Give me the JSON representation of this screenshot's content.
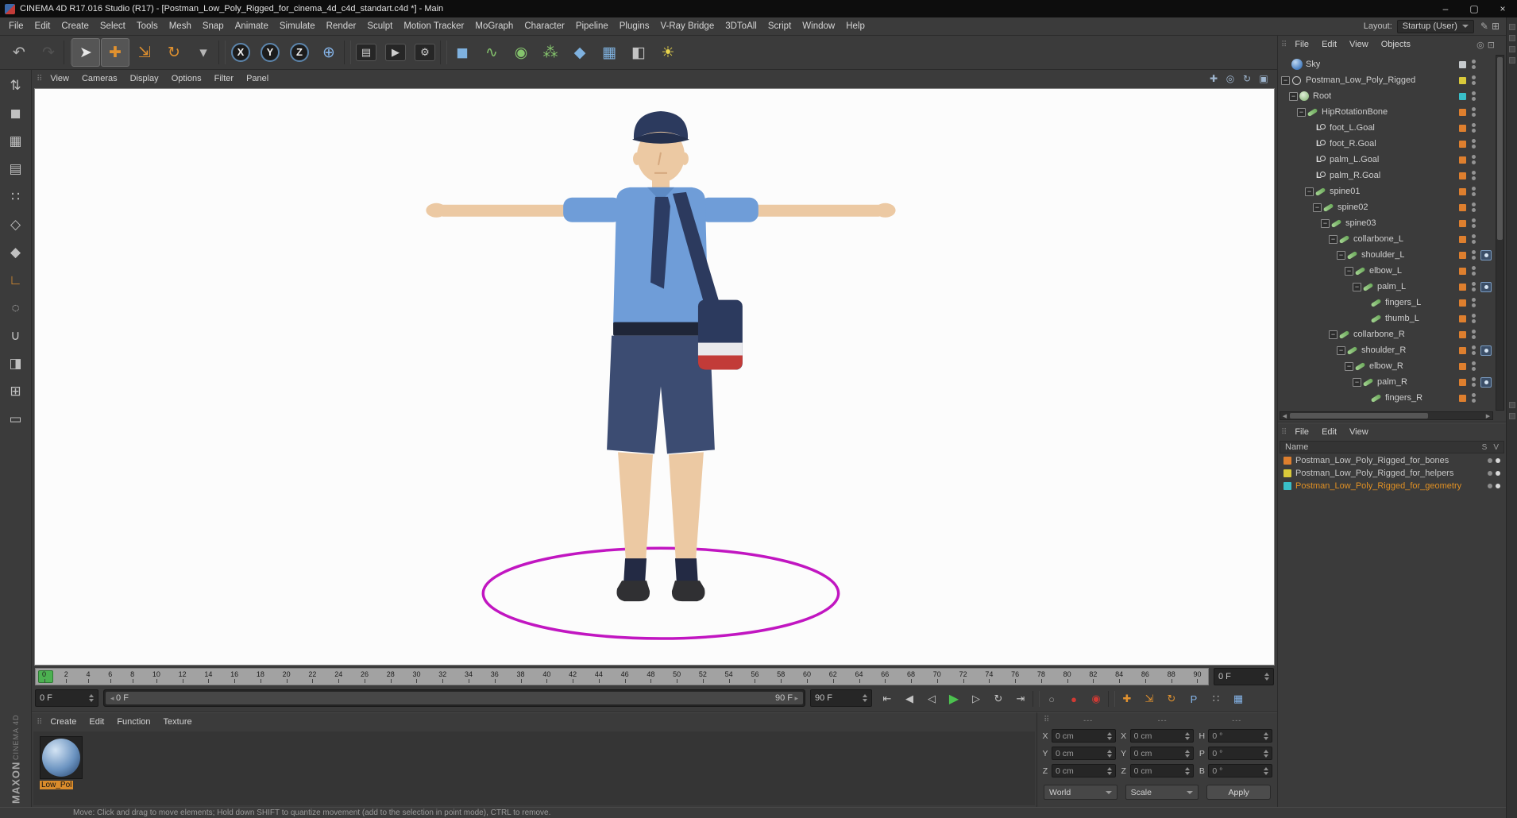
{
  "window": {
    "title": "CINEMA 4D R17.016 Studio (R17) - [Postman_Low_Poly_Rigged_for_cinema_4d_c4d_standart.c4d *] - Main",
    "controls": [
      {
        "name": "minimize-button",
        "glyph": "–"
      },
      {
        "name": "maximize-button",
        "glyph": "▢"
      },
      {
        "name": "close-button",
        "glyph": "×"
      }
    ]
  },
  "menubar": {
    "items": [
      "File",
      "Edit",
      "Create",
      "Select",
      "Tools",
      "Mesh",
      "Snap",
      "Animate",
      "Simulate",
      "Render",
      "Sculpt",
      "Motion Tracker",
      "MoGraph",
      "Character",
      "Pipeline",
      "Plugins",
      "V-Ray Bridge",
      "3DToAll",
      "Script",
      "Window",
      "Help"
    ],
    "layout_label": "Layout:",
    "layout_value": "Startup (User)",
    "right_icons": [
      {
        "name": "interface-edit-icon",
        "glyph": "✎"
      },
      {
        "name": "layout-grid-icon",
        "glyph": "⊞"
      }
    ]
  },
  "toolbar": {
    "icons": [
      {
        "name": "undo-icon",
        "glyph": "↶",
        "color": "#b5b5b5"
      },
      {
        "name": "redo-icon",
        "glyph": "↷",
        "color": "#666666",
        "disabled": true
      },
      {
        "sep": true
      },
      {
        "name": "live-selection-icon",
        "glyph": "➤",
        "color": "#e8e8e8",
        "active": true
      },
      {
        "name": "move-tool-icon",
        "glyph": "✚",
        "color": "#e0912f",
        "active": true
      },
      {
        "name": "scale-tool-icon",
        "glyph": "⇲",
        "color": "#e0912f"
      },
      {
        "name": "rotate-tool-icon",
        "glyph": "↻",
        "color": "#e0912f"
      },
      {
        "name": "last-tool-icon",
        "glyph": "▾",
        "color": "#b5b5b5"
      },
      {
        "sep": true
      },
      {
        "name": "x-axis-lock-icon",
        "glyph": "X",
        "color": "#f0f0f0",
        "chip": "circle"
      },
      {
        "name": "y-axis-lock-icon",
        "glyph": "Y",
        "color": "#f0f0f0",
        "chip": "circle"
      },
      {
        "name": "z-axis-lock-icon",
        "glyph": "Z",
        "color": "#f0f0f0",
        "chip": "circle"
      },
      {
        "name": "coordinate-system-icon",
        "glyph": "⊕",
        "color": "#85b4e8"
      },
      {
        "sep": true
      },
      {
        "name": "render-view-icon",
        "glyph": "▤",
        "color": "#cfcfcf",
        "chip": "dark"
      },
      {
        "name": "render-picture-viewer-icon",
        "glyph": "▶",
        "color": "#cfcfcf",
        "chip": "dark"
      },
      {
        "name": "render-settings-icon",
        "glyph": "⚙",
        "color": "#cfcfcf",
        "chip": "dark"
      },
      {
        "sep": true
      },
      {
        "name": "primitive-cube-icon",
        "glyph": "◼",
        "color": "#7fb2e0"
      },
      {
        "name": "spline-pen-icon",
        "glyph": "∿",
        "color": "#85c46d"
      },
      {
        "name": "subdivision-surface-icon",
        "glyph": "◉",
        "color": "#85c46d"
      },
      {
        "name": "cloner-icon",
        "glyph": "⁂",
        "color": "#85c46d"
      },
      {
        "name": "deformer-icon",
        "glyph": "◆",
        "color": "#7fb2e0"
      },
      {
        "name": "environment-icon",
        "glyph": "▦",
        "color": "#7fb2e0"
      },
      {
        "name": "camera-icon",
        "glyph": "◧",
        "color": "#c4c4c4"
      },
      {
        "name": "light-icon",
        "glyph": "☀",
        "color": "#e8d44c"
      }
    ]
  },
  "left_palette": {
    "icons": [
      {
        "name": "make-editable-icon",
        "glyph": "⇅",
        "color": "#c0c0c0"
      },
      {
        "name": "model-mode-icon",
        "glyph": "◼",
        "color": "#c0c0c0"
      },
      {
        "name": "texture-mode-icon",
        "glyph": "▦",
        "color": "#c0c0c0"
      },
      {
        "name": "workplane-mode-icon",
        "glyph": "▤",
        "color": "#c0c0c0"
      },
      {
        "name": "point-mode-icon",
        "glyph": "∷",
        "color": "#c0c0c0"
      },
      {
        "name": "edge-mode-icon",
        "glyph": "◇",
        "color": "#c0c0c0"
      },
      {
        "name": "polygon-mode-icon",
        "glyph": "◆",
        "color": "#c0c0c0"
      },
      {
        "name": "axis-mode-icon",
        "glyph": "∟",
        "color": "#e0912f"
      },
      {
        "name": "object-mode-icon",
        "glyph": "◌",
        "color": "#c0c0c0"
      },
      {
        "name": "snap-icon",
        "glyph": "∪",
        "color": "#c0c0c0"
      },
      {
        "name": "paint-tool-icon",
        "glyph": "◨",
        "color": "#c0c0c0"
      },
      {
        "name": "texture-axis-icon",
        "glyph": "⊞",
        "color": "#c0c0c0"
      },
      {
        "name": "viewport-solo-icon",
        "glyph": "▭",
        "color": "#c0c0c0"
      }
    ]
  },
  "viewport": {
    "menu": [
      "View",
      "Cameras",
      "Display",
      "Options",
      "Filter",
      "Panel"
    ],
    "view_icons": [
      {
        "name": "pan-view-icon",
        "glyph": "✚"
      },
      {
        "name": "zoom-view-icon",
        "glyph": "◎"
      },
      {
        "name": " rotate-view-icon",
        "glyph": "↻"
      },
      {
        "name": "toggle-view-icon",
        "glyph": "▣"
      }
    ]
  },
  "scene": {
    "description": "Low-poly postman character in T-pose over magenta ground ring",
    "colors": {
      "ring": "#c116c1",
      "skin": "#ecc9a3",
      "skin_line": "#d5a87e",
      "shirt": "#6f9dd8",
      "collar": "#5d8ac4",
      "tie": "#2c3c63",
      "belt": "#1f2638",
      "shorts": "#3c4c72",
      "cap": "#2c3a5e",
      "cap_brim": "#24304e",
      "socks": "#232a44",
      "shoes": "#303033",
      "bag": "#2c3a5e",
      "bag_stripe_white": "#e9e9ec",
      "bag_stripe_red": "#c23b38"
    }
  },
  "timeline": {
    "ticks": [
      0,
      2,
      4,
      6,
      8,
      10,
      12,
      14,
      16,
      18,
      20,
      22,
      24,
      26,
      28,
      30,
      32,
      34,
      36,
      38,
      40,
      42,
      44,
      46,
      48,
      50,
      52,
      54,
      56,
      58,
      60,
      62,
      64,
      66,
      68,
      70,
      72,
      74,
      76,
      78,
      80,
      82,
      84,
      86,
      88,
      90
    ],
    "ruler_frame_field": "0 F",
    "slider_min_field": "0 F",
    "range_start_label": "0 F",
    "range_end_label": "90 F",
    "slider_max_field": "90 F"
  },
  "transport": {
    "buttons": [
      {
        "name": "goto-start-button",
        "glyph": "⇤",
        "color": "#c4c4c4"
      },
      {
        "name": "previous-key-button",
        "glyph": "◀",
        "color": "#c4c4c4"
      },
      {
        "name": "previous-frame-button",
        "glyph": "◁",
        "color": "#c4c4c4"
      },
      {
        "name": "play-button",
        "glyph": "▶",
        "color": "#4cc24f",
        "big": true
      },
      {
        "name": "next-frame-button",
        "glyph": "▷",
        "color": "#c4c4c4"
      },
      {
        "name": "cycle-button",
        "glyph": "↻",
        "color": "#c4c4c4"
      },
      {
        "name": "goto-end-button",
        "glyph": "⇥",
        "color": "#c4c4c4"
      },
      {
        "sep": true
      },
      {
        "name": "play-sound-button",
        "glyph": "○",
        "color": "#9a9a9a"
      },
      {
        "name": "record-button",
        "glyph": "●",
        "color": "#d03a34"
      },
      {
        "name": "autokey-button",
        "glyph": "◉",
        "color": "#d03a34"
      },
      {
        "sep": true
      },
      {
        "name": "key-position-toggle",
        "glyph": "✚",
        "color": "#e0912f"
      },
      {
        "name": "key-scale-toggle",
        "glyph": "⇲",
        "color": "#e0912f"
      },
      {
        "name": "key-rotation-toggle",
        "glyph": "↻",
        "color": "#e0912f"
      },
      {
        "name": "key-parameter-toggle",
        "glyph": "P",
        "color": "#85b4e8"
      },
      {
        "name": "key-pla-toggle",
        "glyph": "∷",
        "color": "#b8b8b8"
      },
      {
        "name": "keyframe-presets-button",
        "glyph": "▦",
        "color": "#85b4e8"
      }
    ]
  },
  "object_manager": {
    "menu": [
      "File",
      "Edit",
      "View",
      "Objects"
    ],
    "right_icons": [
      {
        "name": "search-icon",
        "glyph": "◎"
      },
      {
        "name": "lock-icon",
        "glyph": "⊡"
      }
    ],
    "tree": [
      {
        "label": "Sky",
        "depth": 0,
        "expand": false,
        "icon": "sky",
        "tag": "#c6cacd",
        "ik": false
      },
      {
        "label": "Postman_Low_Poly_Rigged",
        "depth": 0,
        "expand": true,
        "icon": "null",
        "tag": "#d9c93a",
        "ik": false
      },
      {
        "label": "Root",
        "depth": 1,
        "expand": true,
        "icon": "joint",
        "tag": "#39bfc9",
        "ik": false
      },
      {
        "label": "HipRotationBone",
        "depth": 2,
        "expand": true,
        "icon": "bone",
        "tag": "#de7f2e",
        "ik": false
      },
      {
        "label": "foot_L.Goal",
        "depth": 3,
        "expand": false,
        "icon": "goal",
        "tag": "#de7f2e",
        "ik": false
      },
      {
        "label": "foot_R.Goal",
        "depth": 3,
        "expand": false,
        "icon": "goal",
        "tag": "#de7f2e",
        "ik": false
      },
      {
        "label": "palm_L.Goal",
        "depth": 3,
        "expand": false,
        "icon": "goal",
        "tag": "#de7f2e",
        "ik": false
      },
      {
        "label": "palm_R.Goal",
        "depth": 3,
        "expand": false,
        "icon": "goal",
        "tag": "#de7f2e",
        "ik": false
      },
      {
        "label": "spine01",
        "depth": 3,
        "expand": true,
        "icon": "bone",
        "tag": "#de7f2e",
        "ik": false
      },
      {
        "label": "spine02",
        "depth": 4,
        "expand": true,
        "icon": "bone",
        "tag": "#de7f2e",
        "ik": false
      },
      {
        "label": "spine03",
        "depth": 5,
        "expand": true,
        "icon": "bone",
        "tag": "#de7f2e",
        "ik": false
      },
      {
        "label": "collarbone_L",
        "depth": 6,
        "expand": true,
        "icon": "bone",
        "tag": "#de7f2e",
        "ik": false
      },
      {
        "label": "shoulder_L",
        "depth": 7,
        "expand": true,
        "icon": "bone",
        "tag": "#de7f2e",
        "ik": true
      },
      {
        "label": "elbow_L",
        "depth": 8,
        "expand": true,
        "icon": "bone",
        "tag": "#de7f2e",
        "ik": false
      },
      {
        "label": "palm_L",
        "depth": 9,
        "expand": true,
        "icon": "bone",
        "tag": "#de7f2e",
        "ik": true
      },
      {
        "label": "fingers_L",
        "depth": 10,
        "expand": false,
        "icon": "bone",
        "tag": "#de7f2e",
        "ik": false
      },
      {
        "label": "thumb_L",
        "depth": 10,
        "expand": false,
        "icon": "bone",
        "tag": "#de7f2e",
        "ik": false
      },
      {
        "label": "collarbone_R",
        "depth": 6,
        "expand": true,
        "icon": "bone",
        "tag": "#de7f2e",
        "ik": false
      },
      {
        "label": "shoulder_R",
        "depth": 7,
        "expand": true,
        "icon": "bone",
        "tag": "#de7f2e",
        "ik": true
      },
      {
        "label": "elbow_R",
        "depth": 8,
        "expand": true,
        "icon": "bone",
        "tag": "#de7f2e",
        "ik": false
      },
      {
        "label": "palm_R",
        "depth": 9,
        "expand": true,
        "icon": "bone",
        "tag": "#de7f2e",
        "ik": true
      },
      {
        "label": "fingers_R",
        "depth": 10,
        "expand": false,
        "icon": "bone",
        "tag": "#de7f2e",
        "ik": false
      }
    ]
  },
  "layer_manager": {
    "menu": [
      "File",
      "Edit",
      "View"
    ],
    "name_header": "Name",
    "header_columns": [
      "S",
      "V"
    ],
    "rows": [
      {
        "label": "Postman_Low_Poly_Rigged_for_bones",
        "color": "#de7f2e",
        "selected": false
      },
      {
        "label": "Postman_Low_Poly_Rigged_for_helpers",
        "color": "#d9c93a",
        "selected": false
      },
      {
        "label": "Postman_Low_Poly_Rigged_for_geometry",
        "color": "#39bfc9",
        "selected": true
      }
    ]
  },
  "materials": {
    "menu": [
      "Create",
      "Edit",
      "Function",
      "Texture"
    ],
    "items": [
      {
        "label": "Low_Pol"
      }
    ]
  },
  "coordinates": {
    "column_headers": [
      "---",
      "---",
      "---"
    ],
    "fields": [
      {
        "label": "X",
        "value": "0 cm"
      },
      {
        "label": "Y",
        "value": "0 cm"
      },
      {
        "label": "Z",
        "value": "0 cm"
      },
      {
        "label": "X",
        "value": "0 cm"
      },
      {
        "label": "Y",
        "value": "0 cm"
      },
      {
        "label": "Z",
        "value": "0 cm"
      },
      {
        "label": "H",
        "value": "0 °"
      },
      {
        "label": "P",
        "value": "0 °"
      },
      {
        "label": "B",
        "value": "0 °"
      }
    ],
    "system_dropdown": "World",
    "mode_dropdown": "Scale",
    "apply_button": "Apply"
  },
  "statusbar": {
    "text": "Move: Click and drag to move elements; Hold down SHIFT to quantize movement (add to the selection in point mode), CTRL to remove."
  },
  "branding": {
    "maxon": "MAXON",
    "cinema": "CINEMA 4D"
  }
}
